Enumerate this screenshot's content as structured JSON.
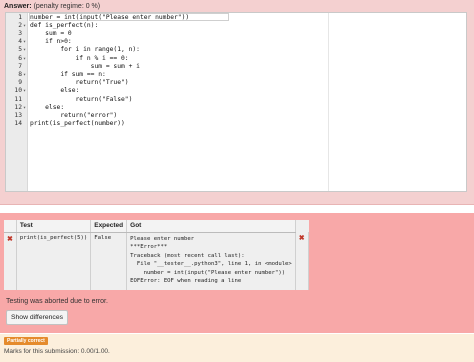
{
  "answer": {
    "label": "Answer:",
    "regime": "(penalty regime: 0 %)"
  },
  "editor": {
    "lines": [
      {
        "n": "1",
        "fold": "",
        "code": "number = int(input(\"Please enter number\"))"
      },
      {
        "n": "2",
        "fold": "▾",
        "code": "def is_perfect(n):"
      },
      {
        "n": "3",
        "fold": "",
        "code": "    sum = 0"
      },
      {
        "n": "4",
        "fold": "▾",
        "code": "    if n>0:"
      },
      {
        "n": "5",
        "fold": "▾",
        "code": "        for i in range(1, n):"
      },
      {
        "n": "6",
        "fold": "▾",
        "code": "            if n % i == 0:"
      },
      {
        "n": "7",
        "fold": "",
        "code": "                sum = sum + i"
      },
      {
        "n": "8",
        "fold": "▾",
        "code": "        if sum == n:"
      },
      {
        "n": "9",
        "fold": "",
        "code": "            return(\"True\")"
      },
      {
        "n": "10",
        "fold": "▾",
        "code": "        else:"
      },
      {
        "n": "11",
        "fold": "",
        "code": "            return(\"False\")"
      },
      {
        "n": "12",
        "fold": "▾",
        "code": "    else:"
      },
      {
        "n": "13",
        "fold": "",
        "code": "        return(\"error\")"
      },
      {
        "n": "14",
        "fold": "",
        "code": "print(is_perfect(number))"
      }
    ]
  },
  "results": {
    "headers": {
      "test": "Test",
      "expected": "Expected",
      "got": "Got"
    },
    "row": {
      "status_icon": "✖",
      "test": "print(is_perfect(5))",
      "expected": "False",
      "got": [
        "Please enter number",
        "***Error***",
        "Traceback (most recent call last):",
        "  File \"__tester__.python3\", line 1, in <module>",
        "    number = int(input(\"Please enter number\"))",
        "EOFError: EOF when reading a line"
      ],
      "result_icon": "✖"
    },
    "abort_message": "Testing was aborted due to error.",
    "show_differences": "Show differences"
  },
  "footer": {
    "badge": "Partially correct",
    "marks": "Marks for this submission: 0.00/1.00."
  },
  "colors": {
    "answer_bg": "#f4d0d0",
    "results_bg": "#f8a8a8",
    "footer_bg": "#fcefdc",
    "badge": "#e58b2c",
    "error_mark": "#c0392b"
  }
}
